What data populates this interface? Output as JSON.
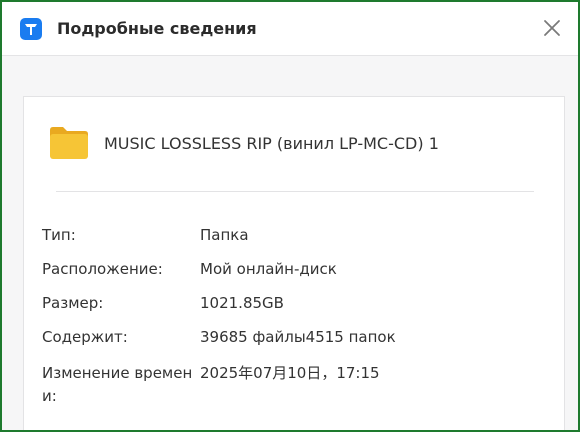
{
  "dialog": {
    "title": "Подробные сведения",
    "accent_color": "#1a7cf0",
    "border_color": "#1e7a2e"
  },
  "item": {
    "icon": "folder-icon",
    "folder_color": "#f6c536",
    "name": "MUSIC LOSSLESS RIP (винил LP-MC-CD) 1"
  },
  "details": [
    {
      "label": "Тип:",
      "value": "Папка"
    },
    {
      "label": "Расположение:",
      "value": "Мой онлайн-диск"
    },
    {
      "label": "Размер:",
      "value": "1021.85GB"
    },
    {
      "label": "Содержит:",
      "value": "39685 файлы4515 папок"
    },
    {
      "label": "Изменение времени:",
      "value": "2025年07月10日，17:15"
    }
  ]
}
